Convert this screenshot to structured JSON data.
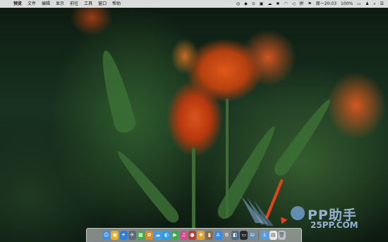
{
  "menubar": {
    "apple_symbol": "",
    "items": [
      "预览",
      "文件",
      "编辑",
      "显示",
      "前往",
      "工具",
      "窗口",
      "帮助"
    ],
    "status": {
      "battery": "100%",
      "time": "周一20:03"
    }
  },
  "watermark": {
    "brand": "PP助手",
    "domain": "25PP.COM"
  },
  "dock": {
    "icons": [
      {
        "name": "finder-icon",
        "color": "#3b8ee0",
        "glyph": "☺"
      },
      {
        "name": "chrome-icon",
        "color": "#e8b12a",
        "glyph": "◉"
      },
      {
        "name": "safari-icon",
        "color": "#2f7fd8",
        "glyph": "✦"
      },
      {
        "name": "launchpad-icon",
        "color": "#606a7a",
        "glyph": "✈"
      },
      {
        "name": "games-icon",
        "color": "#46a84a",
        "glyph": "▦"
      },
      {
        "name": "butterfly-app-icon",
        "color": "#d98a2a",
        "glyph": "✿"
      },
      {
        "name": "messages-icon",
        "color": "#3fa0e8",
        "glyph": "☁"
      },
      {
        "name": "qq-icon",
        "color": "#2b9de8",
        "glyph": "◐"
      },
      {
        "name": "facetime-icon",
        "color": "#3caa4a",
        "glyph": "▶"
      },
      {
        "name": "itunes-icon",
        "color": "#d44a8a",
        "glyph": "♫"
      },
      {
        "name": "photo-booth-icon",
        "color": "#c23a2a",
        "glyph": "●"
      },
      {
        "name": "photos-icon",
        "color": "#e9a12b",
        "glyph": "✸"
      },
      {
        "name": "contacts-icon",
        "color": "#8a6a4a",
        "glyph": "▮"
      },
      {
        "name": "app-store-icon",
        "color": "#3a8ae0",
        "glyph": "A"
      },
      {
        "name": "system-preferences-icon",
        "color": "#8a8a8a",
        "glyph": "⚙"
      },
      {
        "name": "preview-icon",
        "color": "#4a6a8a",
        "glyph": "◧"
      },
      {
        "name": "terminal-icon",
        "color": "#2a2a2a",
        "glyph": "▭"
      },
      {
        "name": "storage-icon",
        "color": "#6a8aaa",
        "glyph": "⛁"
      },
      {
        "name": "downloads-folder-icon",
        "color": "#5aa0e0",
        "glyph": "↓"
      },
      {
        "name": "document-icon",
        "color": "#e8e8e8",
        "glyph": "▤"
      },
      {
        "name": "trash-icon",
        "color": "#b8bcc4",
        "glyph": "🗑"
      }
    ]
  }
}
